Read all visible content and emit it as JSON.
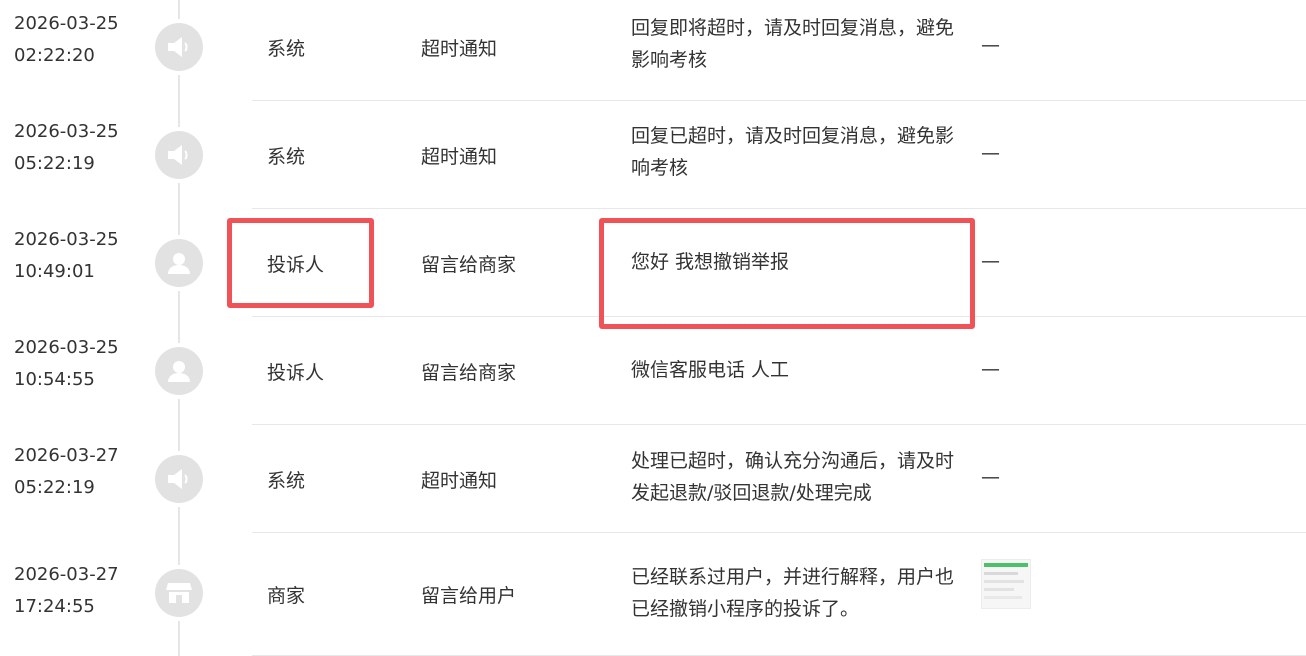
{
  "colors": {
    "highlight": "#ef5358",
    "avatar_bg": "#e2e2e2",
    "icon": "#ffffff",
    "divider": "#e8e8e8"
  },
  "rows": [
    {
      "date": "2026-03-25",
      "time": "02:22:20",
      "avatar_icon": "speaker-icon",
      "role": "系统",
      "type": "超时通知",
      "content": "回复即将超时，请及时回复消息，避免影响考核",
      "attachment": "—"
    },
    {
      "date": "2026-03-25",
      "time": "05:22:19",
      "avatar_icon": "speaker-icon",
      "role": "系统",
      "type": "超时通知",
      "content": "回复已超时，请及时回复消息，避免影响考核",
      "attachment": "—"
    },
    {
      "date": "2026-03-25",
      "time": "10:49:01",
      "avatar_icon": "person-icon",
      "role": "投诉人",
      "type": "留言给商家",
      "content": "您好 我想撤销举报",
      "attachment": "—"
    },
    {
      "date": "2026-03-25",
      "time": "10:54:55",
      "avatar_icon": "person-icon",
      "role": "投诉人",
      "type": "留言给商家",
      "content": "微信客服电话 人工",
      "attachment": "—"
    },
    {
      "date": "2026-03-27",
      "time": "05:22:19",
      "avatar_icon": "speaker-icon",
      "role": "系统",
      "type": "超时通知",
      "content": "处理已超时，确认充分沟通后，请及时发起退款/驳回退款/处理完成",
      "attachment": "—"
    },
    {
      "date": "2026-03-27",
      "time": "17:24:55",
      "avatar_icon": "store-icon",
      "role": "商家",
      "type": "留言给用户",
      "content": "已经联系过用户，并进行解释，用户也已经撤销小程序的投诉了。",
      "attachment_icon": "image-thumbnail-icon"
    }
  ]
}
